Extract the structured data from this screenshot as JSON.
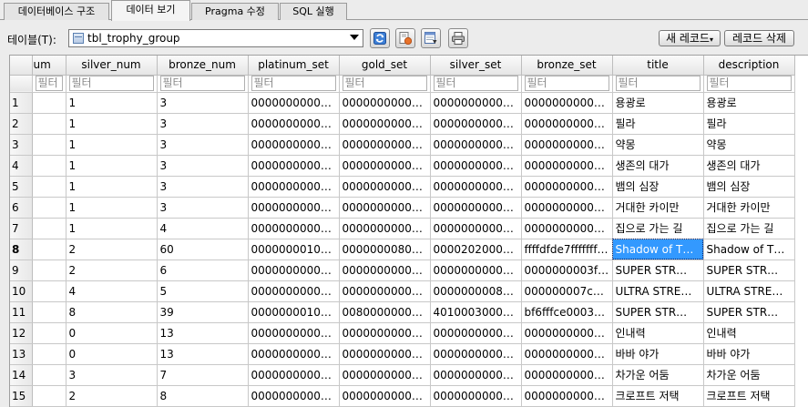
{
  "tabs": [
    {
      "label": "데이터베이스 구조",
      "active": false
    },
    {
      "label": "데이터 보기",
      "active": true
    },
    {
      "label": "Pragma 수정",
      "active": false
    },
    {
      "label": "SQL 실행",
      "active": false
    }
  ],
  "toolbar": {
    "table_label": "테이블(T):",
    "table_value": "tbl_trophy_group",
    "new_record_label": "새 레코드",
    "delete_record_label": "레코드 삭제",
    "icons": [
      "refresh-icon",
      "clear-filters-icon",
      "save-table-icon",
      "print-icon"
    ]
  },
  "grid": {
    "filter_placeholder": "필터",
    "columns": [
      "um",
      "silver_num",
      "bronze_num",
      "platinum_set",
      "gold_set",
      "silver_set",
      "bronze_set",
      "title",
      "description"
    ],
    "selected_row": 8,
    "selected_col": 7,
    "rows": [
      {
        "n": "1",
        "cells": [
          "",
          "1",
          "3",
          "00000000000000…",
          "00000000000000…",
          "00000000000000…",
          "00000000000000…",
          "용광로",
          "용광로"
        ]
      },
      {
        "n": "2",
        "cells": [
          "",
          "1",
          "3",
          "00000000000000…",
          "00000000000000…",
          "00000000000000…",
          "00000000000000…",
          "필라",
          "필라"
        ]
      },
      {
        "n": "3",
        "cells": [
          "",
          "1",
          "3",
          "00000000000000…",
          "00000000000000…",
          "00000000000000…",
          "00000000000000…",
          "약몽",
          "약몽"
        ]
      },
      {
        "n": "4",
        "cells": [
          "",
          "1",
          "3",
          "00000000000000…",
          "00000000000000…",
          "00000000000000…",
          "00000000000000…",
          "생존의 대가",
          "생존의 대가"
        ]
      },
      {
        "n": "5",
        "cells": [
          "",
          "1",
          "3",
          "00000000000000…",
          "00000000000000…",
          "00000000000000…",
          "00000000000000…",
          "뱀의 심장",
          "뱀의 심장"
        ]
      },
      {
        "n": "6",
        "cells": [
          "",
          "1",
          "3",
          "00000000000000…",
          "00000000000000…",
          "00000000000000…",
          "00000000000000…",
          "거대한 카이만",
          "거대한 카이만"
        ]
      },
      {
        "n": "7",
        "cells": [
          "",
          "1",
          "4",
          "00000000000000…",
          "00000000000000…",
          "00000000000000…",
          "00000000000000…",
          "집으로 가는 길",
          "집으로 가는 길"
        ]
      },
      {
        "n": "8",
        "cells": [
          "",
          "2",
          "60",
          "000000001000…",
          "00000000800…",
          "00002020000…",
          "ffffdfde7fffffff0…",
          "Shadow of T…",
          "Shadow of T…"
        ]
      },
      {
        "n": "9",
        "cells": [
          "",
          "2",
          "6",
          "00000000000000…",
          "00000000000000…",
          "00000000000000…",
          "0000000003f0…",
          "SUPER STR…",
          "SUPER STR…"
        ]
      },
      {
        "n": "10",
        "cells": [
          "",
          "4",
          "5",
          "00000000000000…",
          "00000000000000…",
          "000000000800…",
          "000000007c0…",
          "ULTRA STRE…",
          "ULTRA STRE…"
        ]
      },
      {
        "n": "11",
        "cells": [
          "",
          "8",
          "39",
          "000000001000…",
          "00800000000…",
          "40100030000…",
          "bf6fffce0003d…",
          "SUPER STR…",
          "SUPER STR…"
        ]
      },
      {
        "n": "12",
        "cells": [
          "",
          "0",
          "13",
          "00000000000000…",
          "00000000000000…",
          "00000000000000…",
          "00000000000000…",
          "인내력",
          "인내력"
        ]
      },
      {
        "n": "13",
        "cells": [
          "",
          "0",
          "13",
          "00000000000000…",
          "00000000000000…",
          "00000000000000…",
          "00000000000000…",
          "바바 야가",
          "바바 야가"
        ]
      },
      {
        "n": "14",
        "cells": [
          "",
          "3",
          "7",
          "00000000000000…",
          "00000000000000…",
          "00000000000000…",
          "00000000000000…",
          "차가운 어둠",
          "차가운 어둠"
        ]
      },
      {
        "n": "15",
        "cells": [
          "",
          "2",
          "8",
          "00000000000000…",
          "00000000000000…",
          "00000000000000…",
          "00000000000000…",
          "크로프트 저택",
          "크로프트 저택"
        ]
      }
    ]
  }
}
